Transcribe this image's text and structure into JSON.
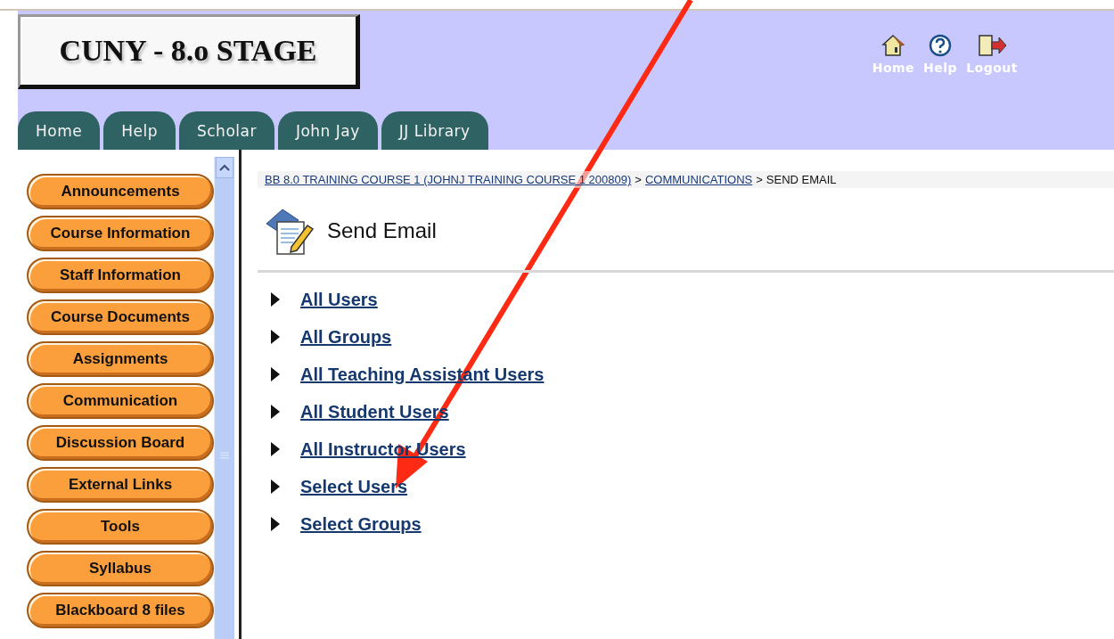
{
  "header": {
    "logo": "CUNY - 8.o STAGE",
    "tabs": [
      {
        "label": "Home"
      },
      {
        "label": "Help"
      },
      {
        "label": "Scholar"
      },
      {
        "label": "John Jay"
      },
      {
        "label": "JJ Library"
      }
    ],
    "top_links": [
      {
        "kind": "home",
        "label": "Home"
      },
      {
        "kind": "help",
        "label": "Help"
      },
      {
        "kind": "logout",
        "label": "Logout"
      }
    ]
  },
  "course_menu": [
    "Announcements",
    "Course Information",
    "Staff Information",
    "Course Documents",
    "Assignments",
    "Communication",
    "Discussion Board",
    "External Links",
    "Tools",
    "Syllabus",
    "Blackboard 8 files"
  ],
  "breadcrumb": {
    "links": [
      "BB 8.0 TRAINING COURSE 1 (JOHNJ TRAINING COURSE 1 200809)",
      "COMMUNICATIONS"
    ],
    "separator": ">",
    "current": "SEND EMAIL"
  },
  "page_title": "Send Email",
  "recipient_options": [
    "All Users",
    "All Groups",
    "All Teaching Assistant Users",
    "All Student Users",
    "All Instructor Users",
    "Select Users",
    "Select Groups"
  ]
}
